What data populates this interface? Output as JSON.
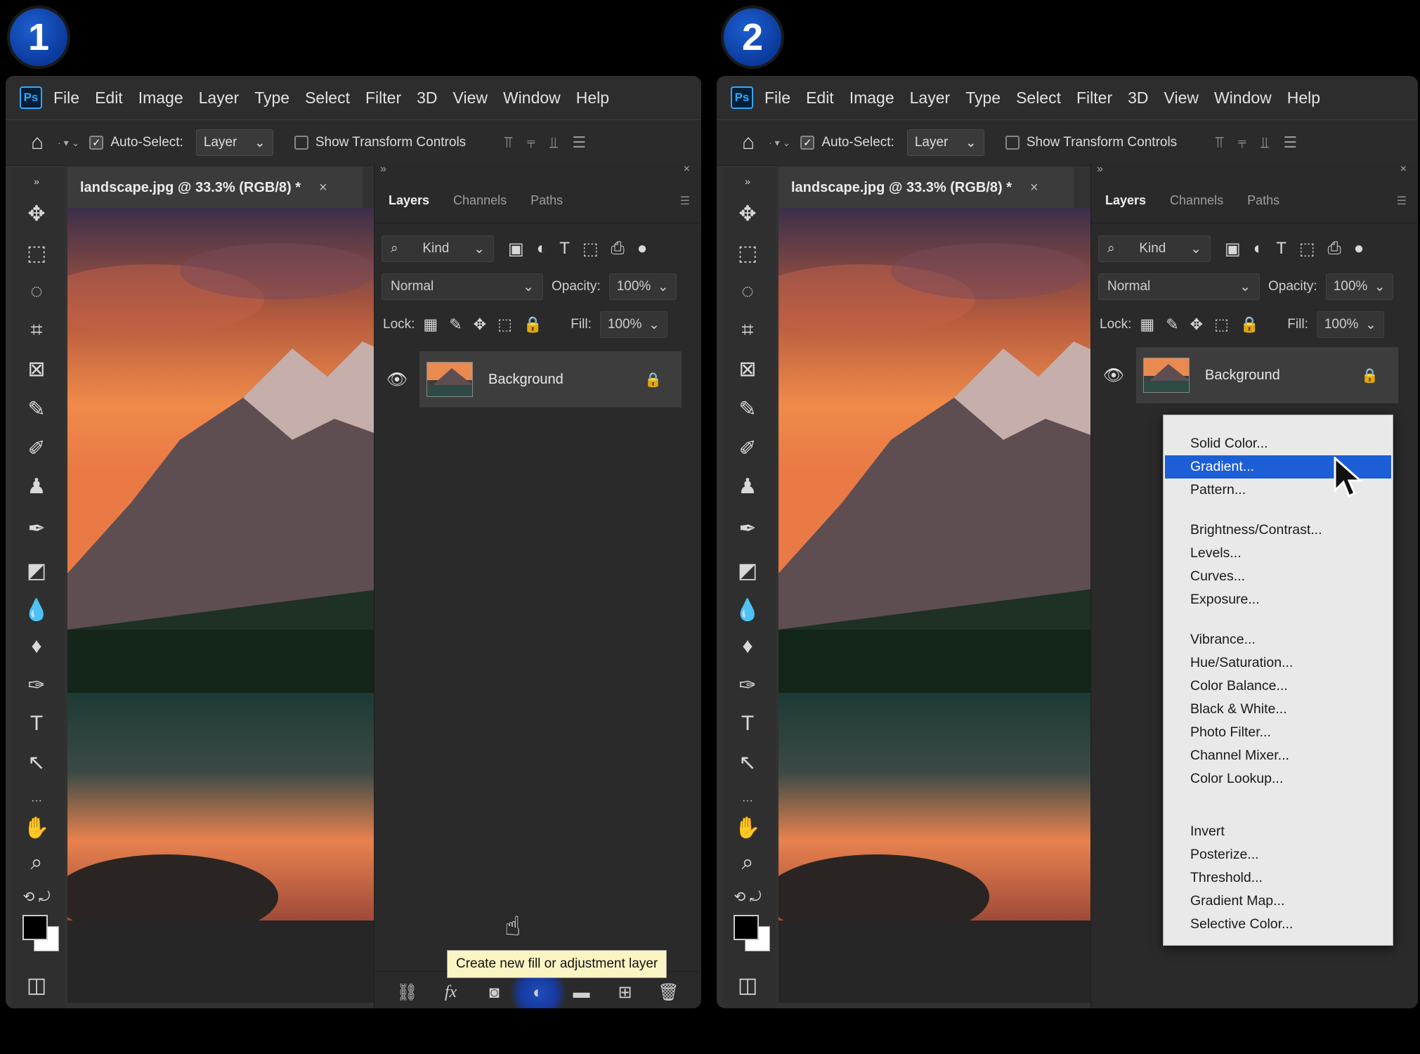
{
  "steps": [
    "1",
    "2"
  ],
  "menubar": {
    "logo": "Ps",
    "items": [
      "File",
      "Edit",
      "Image",
      "Layer",
      "Type",
      "Select",
      "Filter",
      "3D",
      "View",
      "Window",
      "Help"
    ]
  },
  "options_bar": {
    "auto_select_label": "Auto-Select:",
    "auto_select_value": "Layer",
    "show_transform_label": "Show Transform Controls"
  },
  "document": {
    "tab_title": "landscape.jpg @ 33.3% (RGB/8) *",
    "close": "×"
  },
  "layers_panel": {
    "tabs": [
      "Layers",
      "Channels",
      "Paths"
    ],
    "filter_kind": "Kind",
    "blend_mode": "Normal",
    "opacity_label": "Opacity:",
    "opacity_value": "100%",
    "lock_label": "Lock:",
    "fill_label": "Fill:",
    "fill_value": "100%",
    "layer_name": "Background"
  },
  "tooltip": "Create new fill or adjustment layer",
  "fill_menu": {
    "groups": [
      [
        "Solid Color...",
        "Gradient...",
        "Pattern..."
      ],
      [
        "Brightness/Contrast...",
        "Levels...",
        "Curves...",
        "Exposure..."
      ],
      [
        "Vibrance...",
        "Hue/Saturation...",
        "Color Balance...",
        "Black & White...",
        "Photo Filter...",
        "Channel Mixer...",
        "Color Lookup..."
      ],
      [
        "Invert",
        "Posterize...",
        "Threshold...",
        "Gradient Map...",
        "Selective Color..."
      ]
    ],
    "highlighted": "Gradient..."
  },
  "colors": {
    "accent": "#1c5ed6",
    "badge": "#0b3a9c",
    "ps_blue": "#31a8ff"
  }
}
